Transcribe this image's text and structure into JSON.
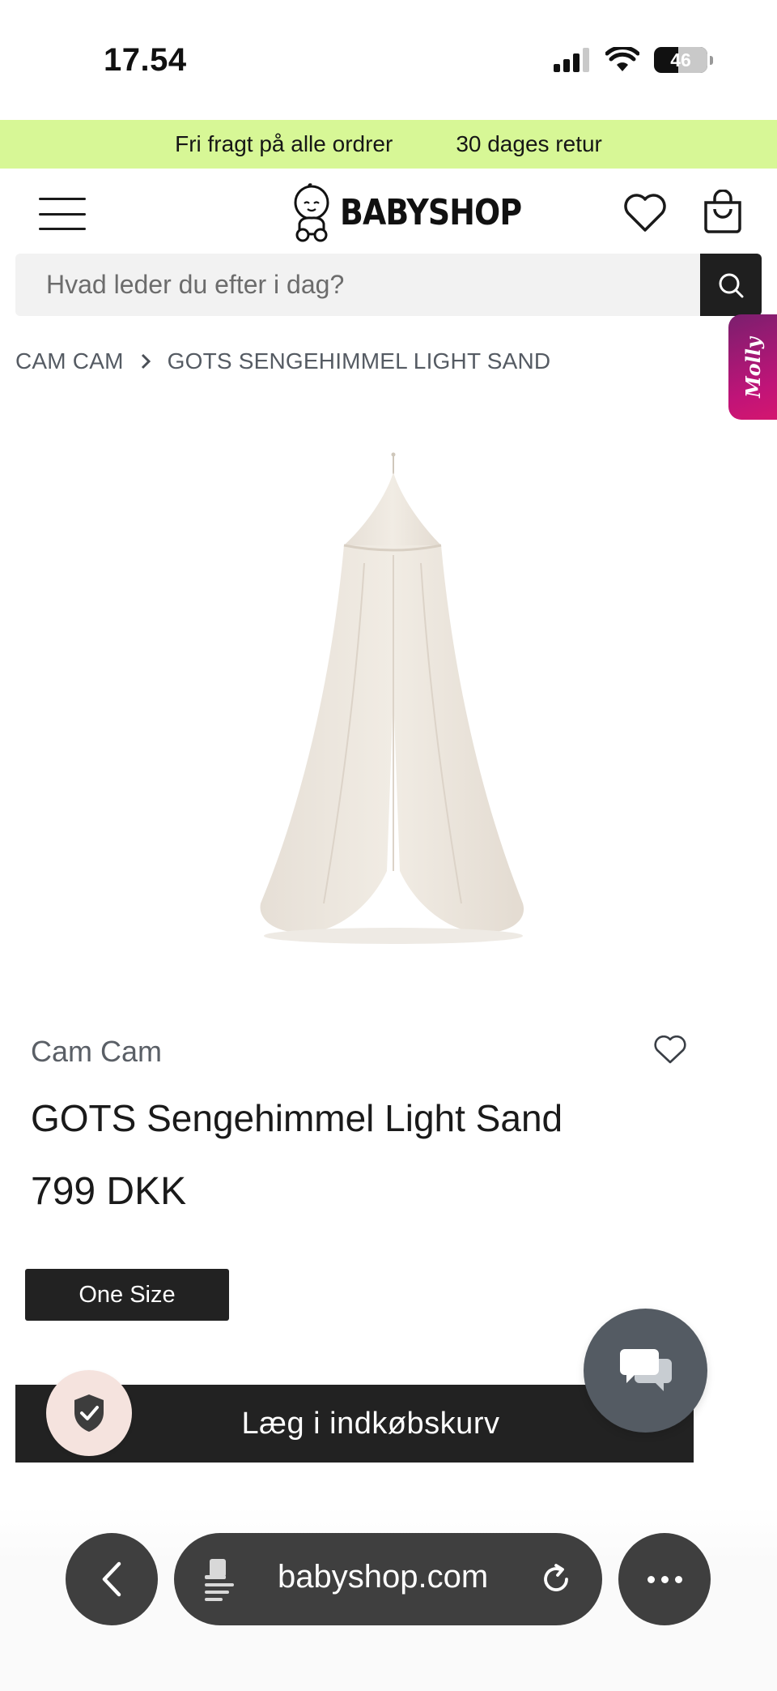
{
  "status_bar": {
    "time": "17.54",
    "battery": "46",
    "battery_level": 0.46
  },
  "promo": {
    "items": [
      "Fri fragt på alle ordrer",
      "30 dages retur"
    ],
    "background": "#d7f796"
  },
  "header": {
    "logo_text": "BABYSHOP",
    "icons": [
      "menu-icon",
      "heart-icon",
      "shopping-bag-icon"
    ]
  },
  "search": {
    "placeholder": "Hvad leder du efter i dag?",
    "value": ""
  },
  "side_tab": {
    "label": "Molly"
  },
  "breadcrumb": {
    "items": [
      "CAM CAM",
      "GOTS SENGEHIMMEL LIGHT SAND"
    ]
  },
  "product": {
    "brand": "Cam Cam",
    "title": "GOTS Sengehimmel Light Sand",
    "price": "799 DKK",
    "size": "One Size",
    "add_to_cart": "Læg i indkøbskurv",
    "image_icon": "bed-canopy-image"
  },
  "browser": {
    "url": "babyshop.com",
    "icons": [
      "back-icon",
      "reader-icon",
      "reload-icon",
      "more-icon"
    ]
  },
  "colors": {
    "accent_green": "#d7f796",
    "dark": "#222222",
    "chat": "#545b63",
    "molly_gradient": "#c01478"
  }
}
